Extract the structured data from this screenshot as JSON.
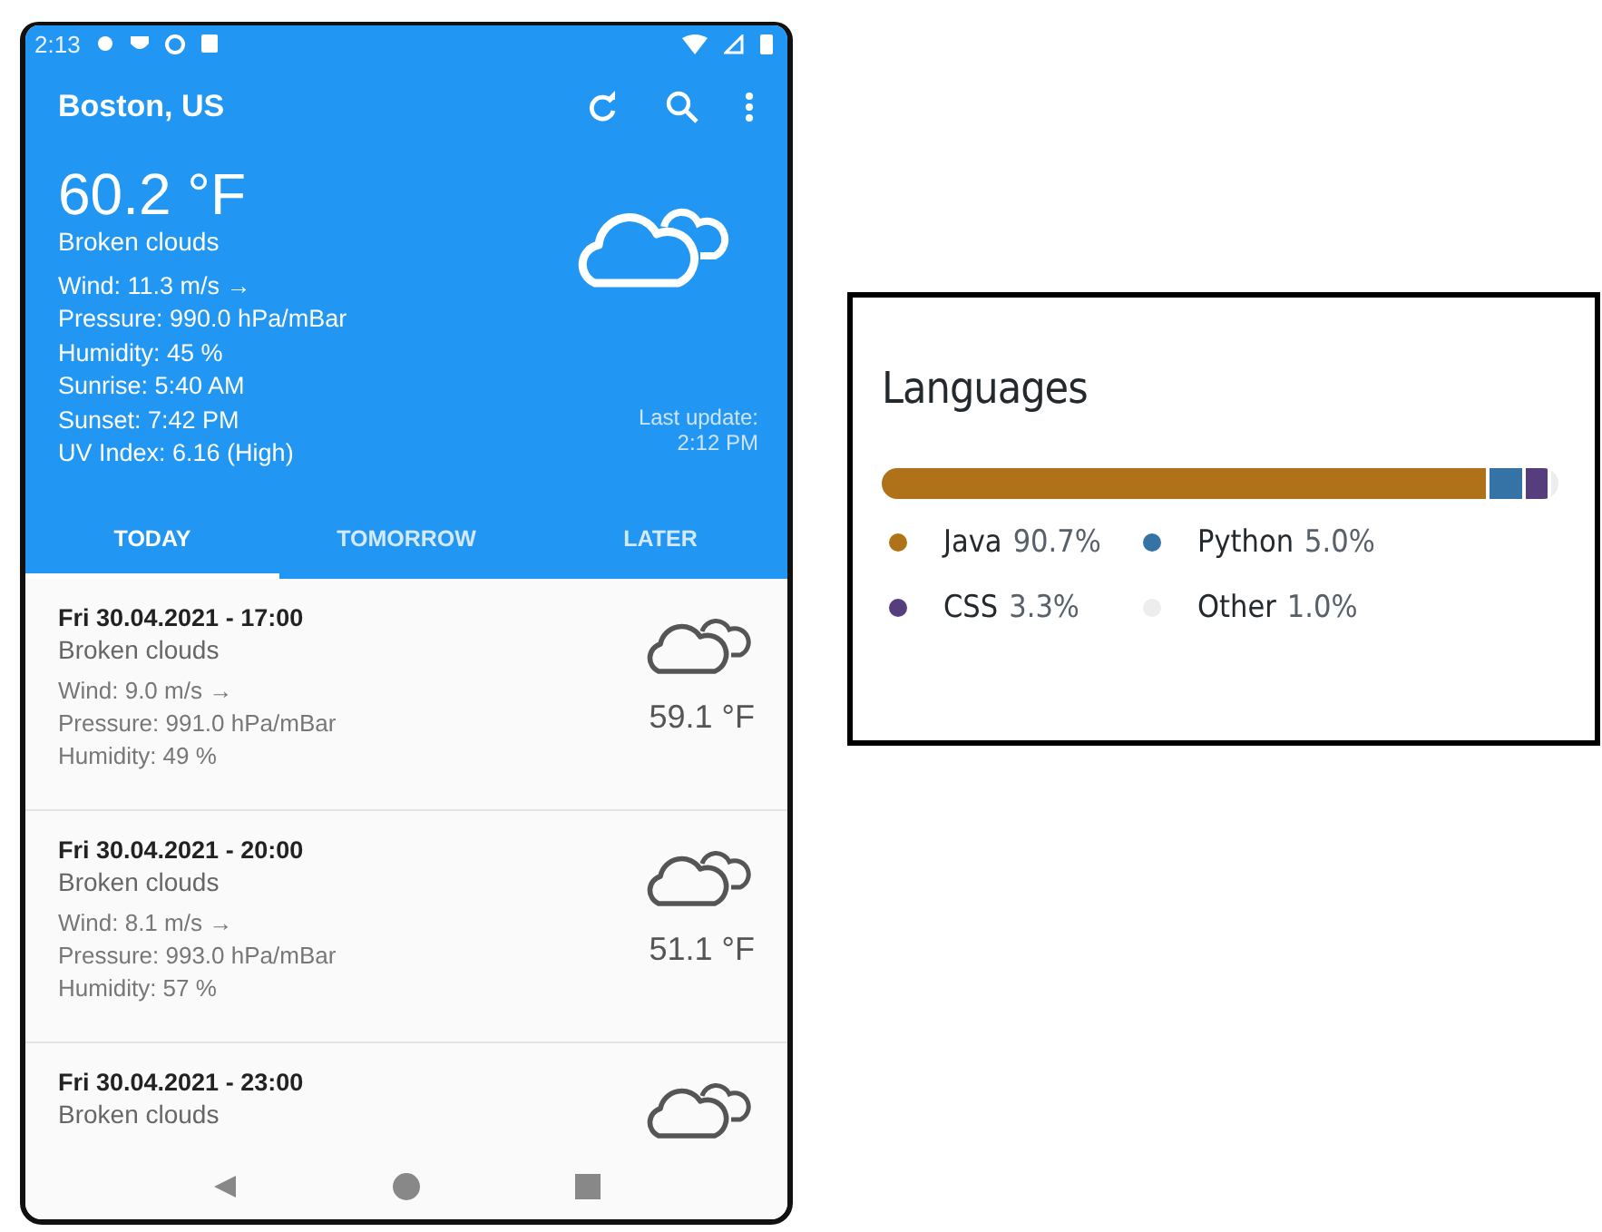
{
  "status_bar": {
    "time": "2:13"
  },
  "app_bar": {
    "title": "Boston, US"
  },
  "current": {
    "temperature": "60.2 °F",
    "description": "Broken clouds",
    "details": [
      "Wind: 11.3 m/s →",
      "Pressure: 990.0 hPa/mBar",
      "Humidity: 45 %",
      "Sunrise: 5:40 AM",
      "Sunset: 7:42 PM",
      "UV Index: 6.16 (High)"
    ],
    "last_update": [
      "Last update:",
      "2:12 PM"
    ]
  },
  "tabs": [
    {
      "label": "TODAY",
      "selected": true
    },
    {
      "label": "TOMORROW",
      "selected": false
    },
    {
      "label": "LATER",
      "selected": false
    }
  ],
  "forecast": [
    {
      "datetime": "Fri 30.04.2021 - 17:00",
      "description": "Broken clouds",
      "details": [
        "Wind: 9.0 m/s →",
        "Pressure: 991.0 hPa/mBar",
        "Humidity: 49 %"
      ],
      "temperature": "59.1 °F"
    },
    {
      "datetime": "Fri 30.04.2021 - 20:00",
      "description": "Broken clouds",
      "details": [
        "Wind: 8.1 m/s →",
        "Pressure: 993.0 hPa/mBar",
        "Humidity: 57 %"
      ],
      "temperature": "51.1 °F"
    },
    {
      "datetime": "Fri 30.04.2021 - 23:00",
      "description": "Broken clouds"
    }
  ],
  "languages": {
    "title": "Languages",
    "items": [
      {
        "name": "Java",
        "percent": "90.7%",
        "color": "#b07219"
      },
      {
        "name": "Python",
        "percent": "5.0%",
        "color": "#3572a5"
      },
      {
        "name": "CSS",
        "percent": "3.3%",
        "color": "#563d7c"
      },
      {
        "name": "Other",
        "percent": "1.0%",
        "color": "#ededed"
      }
    ]
  }
}
